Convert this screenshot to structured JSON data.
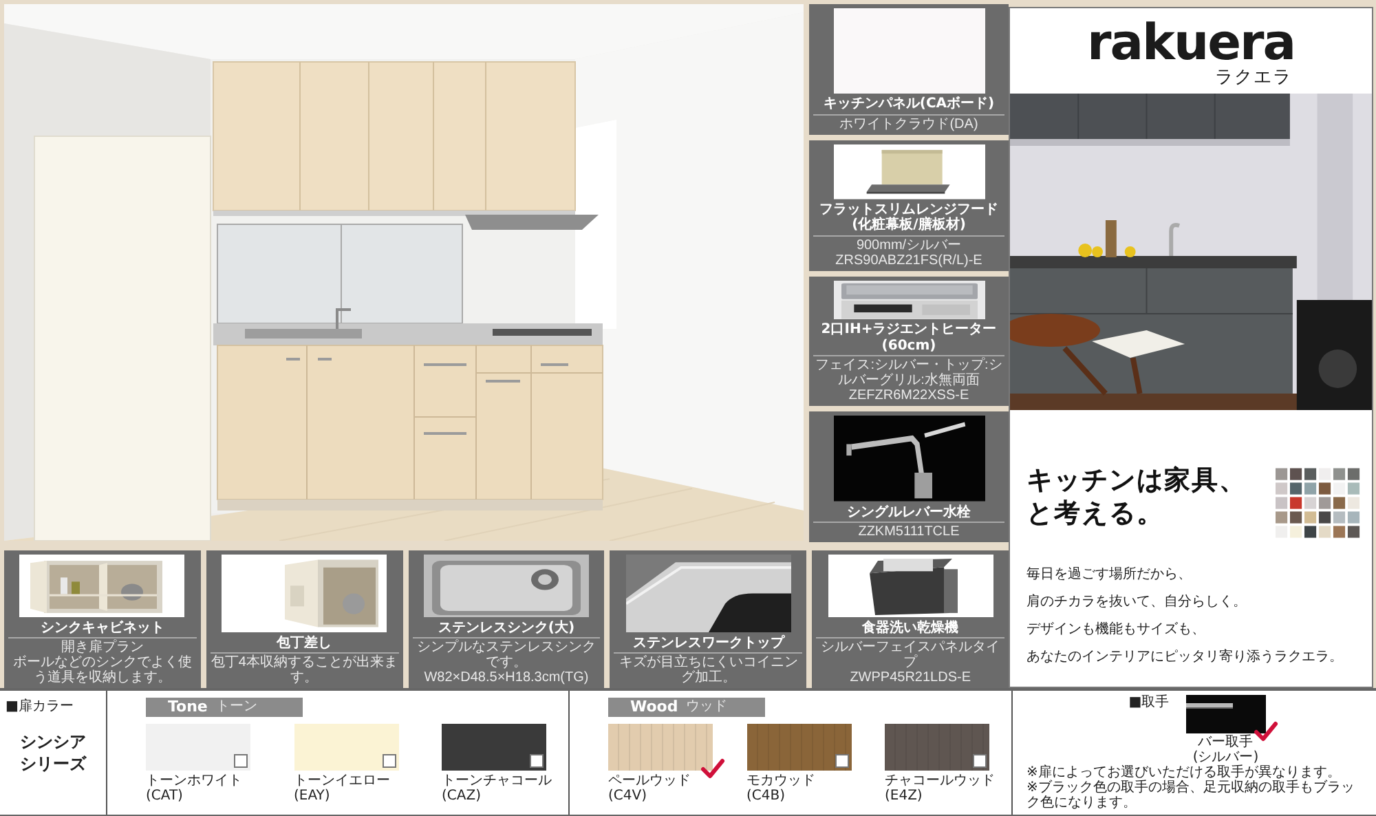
{
  "side_features": [
    {
      "kind": "panel",
      "title": "キッチンパネル(CAボード)",
      "caption": [
        "ホワイトクラウド(DA)"
      ]
    },
    {
      "kind": "hood",
      "title": "フラットスリムレンジフード(化粧幕板/膳板材)",
      "caption": [
        "900mm/シルバー",
        "ZRS90ABZ21FS(R/L)-E"
      ]
    },
    {
      "kind": "cooktop",
      "title": "2口IH+ラジエントヒーター(60cm)",
      "caption": [
        "フェイス:シルバー・トップ:シルバーグリル:水無両面",
        "ZEFZR6M22XSS-E"
      ]
    },
    {
      "kind": "faucet",
      "title": "シングルレバー水栓",
      "caption": [
        "ZZKM5111TCLE"
      ]
    }
  ],
  "bottom_features": [
    {
      "kind": "cabinet",
      "title": "シンクキャビネット",
      "caption": [
        "開き扉プラン",
        "ボールなどのシンクでよく使う道具を収納します。"
      ]
    },
    {
      "kind": "knives",
      "title": "包丁差し",
      "caption": [
        "包丁4本収納することが出来ます。"
      ]
    },
    {
      "kind": "sink",
      "title": "ステンレスシンク(大)",
      "caption": [
        "シンプルなステンレスシンクです。",
        "W82×D48.5×H18.3cm(TG)"
      ]
    },
    {
      "kind": "worktop",
      "title": "ステンレスワークトップ",
      "caption": [
        "キズが目立ちにくいコイニング加工。"
      ]
    },
    {
      "kind": "dishwasher",
      "title": "食器洗い乾燥機",
      "caption": [
        "シルバーフェイスパネルタイプ",
        "ZWPP45R21LDS-E"
      ]
    }
  ],
  "brand_panel": {
    "logo": "rakuera",
    "logo_kana": "ラクエラ",
    "headline": [
      "キッチンは家具、",
      "と考える。"
    ],
    "body": [
      "毎日を過ごす場所だから、",
      "肩のチカラを抜いて、自分らしく。",
      "デザインも機能もサイズも、",
      "あなたのインテリアにピッタリ寄り添うラクエラ。"
    ]
  },
  "door_colors": {
    "heading": "■扉カラー",
    "series": [
      "シンシア",
      "シリーズ"
    ],
    "groups": [
      {
        "kind": "solid",
        "name": "Tone",
        "name_kana": "トーン",
        "swatches": [
          {
            "name": "トーンホワイト",
            "code": "(CAT)",
            "color": "#f1f1f1",
            "selected": false
          },
          {
            "name": "トーンイエロー",
            "code": "(EAY)",
            "color": "#fbf3d4",
            "selected": false
          },
          {
            "name": "トーンチャコール",
            "code": "(CAZ)",
            "color": "#3a3a3a",
            "selected": false
          }
        ]
      },
      {
        "kind": "grain",
        "name": "Wood",
        "name_kana": "ウッド",
        "swatches": [
          {
            "name": "ペールウッド",
            "code": "(C4V)",
            "color": "#e2ccae",
            "selected": true
          },
          {
            "name": "モカウッド",
            "code": "(C4B)",
            "color": "#8a6539",
            "selected": false
          },
          {
            "name": "チャコールウッド",
            "code": "(E4Z)",
            "color": "#5f5651",
            "selected": false
          }
        ]
      }
    ]
  },
  "handle": {
    "heading": "■取手",
    "options": [
      {
        "label": [
          "バー取手",
          "(シルバー)"
        ],
        "selected": true
      }
    ],
    "notes": [
      "※扉によってお選びいただける取手が異なります。",
      "※ブラック色の取手の場合、足元収納の取手もブラック色になります。"
    ]
  }
}
